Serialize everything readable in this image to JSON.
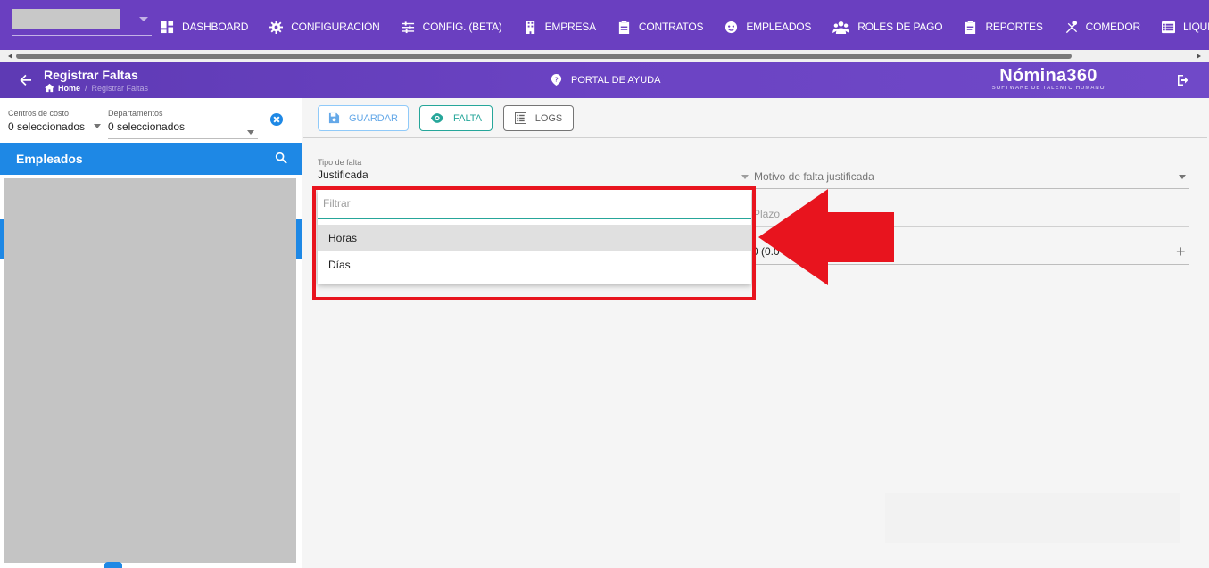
{
  "nav": {
    "items": [
      {
        "label": "DASHBOARD",
        "icon": "dashboard-icon"
      },
      {
        "label": "CONFIGURACIÓN",
        "icon": "gear-icon"
      },
      {
        "label": "CONFIG. (BETA)",
        "icon": "sliders-icon"
      },
      {
        "label": "EMPRESA",
        "icon": "building-icon"
      },
      {
        "label": "CONTRATOS",
        "icon": "clipboard-icon"
      },
      {
        "label": "EMPLEADOS",
        "icon": "face-icon"
      },
      {
        "label": "ROLES DE PAGO",
        "icon": "group-icon"
      },
      {
        "label": "REPORTES",
        "icon": "report-icon"
      },
      {
        "label": "COMEDOR",
        "icon": "utensils-icon"
      },
      {
        "label": "LIQUIDACIONES",
        "icon": "list-icon"
      }
    ]
  },
  "header": {
    "title": "Registrar Faltas",
    "breadcrumb_home": "Home",
    "breadcrumb_current": "Registrar Faltas",
    "help_label": "PORTAL DE AYUDA",
    "brand_name": "Nómina360",
    "brand_tagline": "SOFTWARE DE TALENTO HUMANO"
  },
  "left": {
    "cost_centers_label": "Centros de costo",
    "cost_centers_value": "0 seleccionados",
    "departments_label": "Departamentos",
    "departments_value": "0 seleccionados",
    "employees_title": "Empleados"
  },
  "toolbar": {
    "save_label": "GUARDAR",
    "falta_label": "FALTA",
    "logs_label": "LOGS"
  },
  "form": {
    "tipo_label": "Tipo de falta",
    "tipo_value": "Justificada",
    "motivo_placeholder": "Motivo de falta justificada",
    "plazo_placeholder": "Plazo",
    "quantity_partial": "0 (0.0"
  },
  "dropdown": {
    "filter_placeholder": "Filtrar",
    "options": [
      "Horas",
      "Días"
    ]
  },
  "colors": {
    "nav_bg": "#6a3fc0",
    "accent_blue": "#1e88e5",
    "teal": "#26a69a",
    "annotation_red": "#e8141e"
  }
}
